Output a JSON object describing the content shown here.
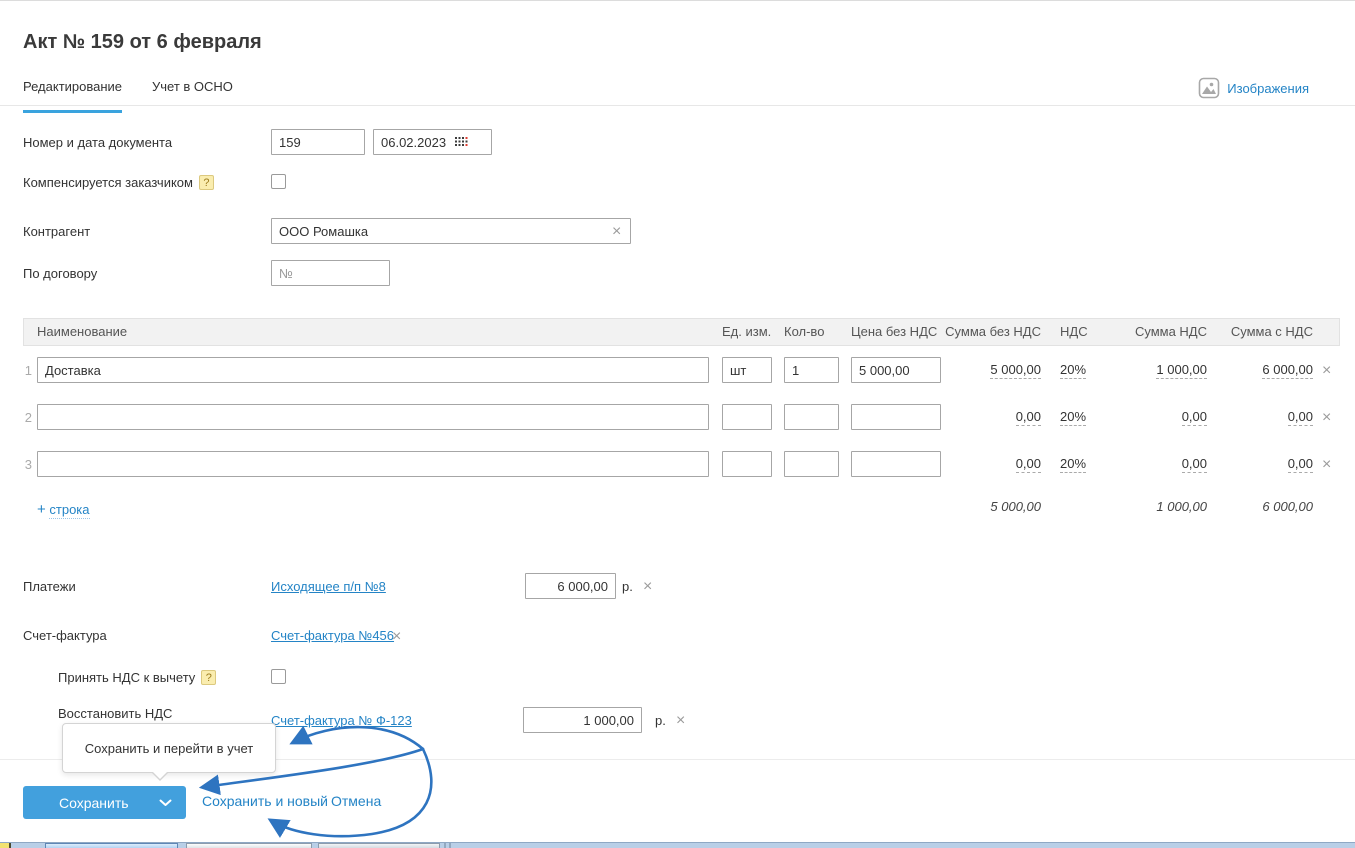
{
  "ui": {
    "help_icon": "?",
    "remove_icon": "×"
  },
  "page": {
    "title": "Акт № 159 от 6 февраля"
  },
  "tabs": {
    "editing": "Редактирование",
    "osno": "Учет в ОСНО"
  },
  "header": {
    "images_label": "Изображения"
  },
  "form": {
    "doc_number_label": "Номер и дата документа",
    "doc_number_value": "159",
    "doc_date_value": "06.02.2023",
    "compensated_label": "Компенсируется заказчиком",
    "counterparty_label": "Контрагент",
    "counterparty_value": "ООО Ромашка",
    "contract_label": "По договору",
    "contract_placeholder": "№"
  },
  "table": {
    "headers": {
      "name": "Наименование",
      "unit": "Ед. изм.",
      "qty": "Кол-во",
      "price": "Цена без НДС",
      "sum_no_vat": "Сумма без НДС",
      "vat": "НДС",
      "vat_sum": "Сумма НДС",
      "sum_with_vat": "Сумма с НДС"
    },
    "rows": [
      {
        "num": "1",
        "name": "Доставка",
        "unit": "шт",
        "qty": "1",
        "price": "5 000,00",
        "sum_no_vat": "5 000,00",
        "vat": "20%",
        "vat_sum": "1 000,00",
        "sum_with_vat": "6 000,00"
      },
      {
        "num": "2",
        "name": "",
        "unit": "",
        "qty": "",
        "price": "",
        "sum_no_vat": "0,00",
        "vat": "20%",
        "vat_sum": "0,00",
        "sum_with_vat": "0,00"
      },
      {
        "num": "3",
        "name": "",
        "unit": "",
        "qty": "",
        "price": "",
        "sum_no_vat": "0,00",
        "vat": "20%",
        "vat_sum": "0,00",
        "sum_with_vat": "0,00"
      }
    ],
    "totals": {
      "sum_no_vat": "5 000,00",
      "vat_sum": "1 000,00",
      "sum_with_vat": "6 000,00"
    },
    "add_plus": "+",
    "add_label": "строка"
  },
  "payments": {
    "label": "Платежи",
    "doc_link": "Исходящее п/п №8",
    "amount": "6 000,00",
    "currency": "р."
  },
  "invoice": {
    "label": "Счет-фактура",
    "doc_link": "Счет-фактура №456"
  },
  "vat_deduct": {
    "label": "Принять НДС к вычету"
  },
  "vat_restore": {
    "label": "Восстановить НДС",
    "doc_link": "Счет-фактура № Ф-123",
    "amount": "1 000,00",
    "currency": "р."
  },
  "footer": {
    "tooltip": "Сохранить и перейти в учет",
    "save_label": "Сохранить",
    "save_and_new_label": "Сохранить и новый",
    "cancel_label": "Отмена"
  },
  "colors": {
    "accent": "#42a0dd",
    "link": "#2484c6",
    "arrow": "#2e74c0",
    "tab_underline": "#3aa3de"
  }
}
